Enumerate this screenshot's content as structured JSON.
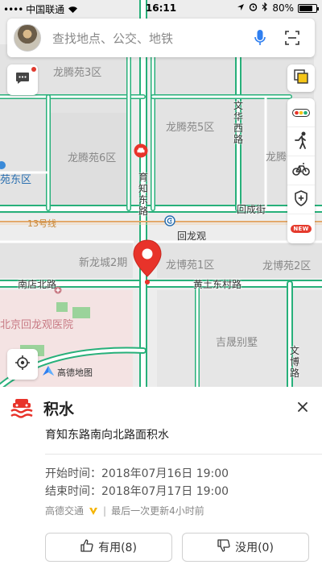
{
  "status_bar": {
    "carrier": "中国联通",
    "time": "16:11",
    "battery": "80%",
    "battery_level": 0.8
  },
  "search": {
    "placeholder": "查找地点、公交、地铁"
  },
  "map": {
    "area_labels": [
      "龙腾苑3区",
      "龙腾苑5区",
      "龙腾苑6区",
      "龙腾",
      "苑东区",
      "新龙城2期",
      "龙博苑1区",
      "龙博苑2区",
      "吉晟别墅"
    ],
    "roads": {
      "yuzhi_east_rd": "育知东路",
      "wenhua_west_rd": "文华西路",
      "huicheng_st": "回成街",
      "nandian_north_rd": "南店北路",
      "huangtu_east_village_rd": "黄土东村路",
      "wenbo_rd": "文博路"
    },
    "metro_line": "13号线",
    "station": "回龙观",
    "hospital": "北京回龙观医院",
    "brand": "高德地图",
    "colors": {
      "road_edge": "#27b07a",
      "road_fill": "#ffffff",
      "block_fill": "#e3e3e3",
      "hospital_fill": "#f4e3e3",
      "park_green": "#9bd39b",
      "pin_red": "#e8332a",
      "rail": "#e3a86a"
    }
  },
  "toolbar": {
    "layers_icon": "layers-icon",
    "traffic_icon": "traffic-light-icon",
    "walk_icon": "pedestrian-icon",
    "bike_icon": "bicycle-icon",
    "safety_icon": "shield-plus-icon",
    "new_badge": "NEW"
  },
  "event": {
    "title": "积水",
    "description": "育知东路南向北路面积水",
    "start_label": "开始时间：",
    "start_value": "2018年07月16日 19:00",
    "end_label": "结束时间：",
    "end_value": "2018年07月17日 19:00",
    "source": "高德交通",
    "updated": "最后一次更新4小时前",
    "useful_label": "有用(8)",
    "useless_label": "没用(0)"
  }
}
